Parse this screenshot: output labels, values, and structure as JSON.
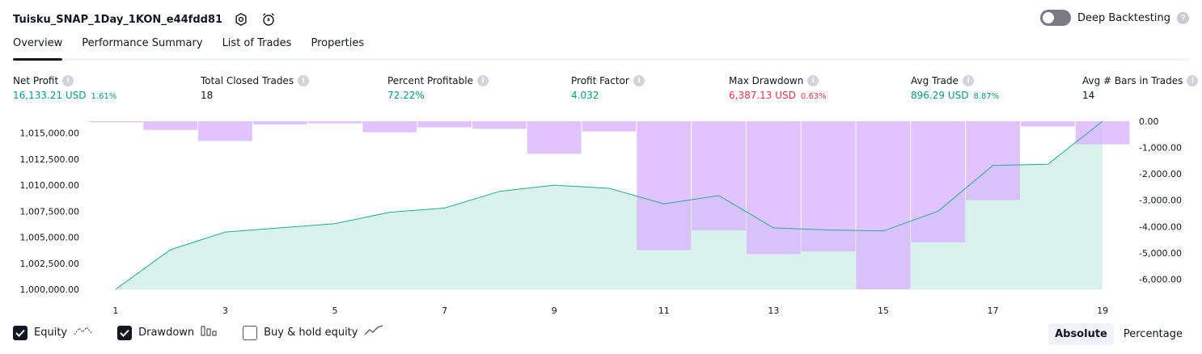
{
  "header": {
    "strategy_name": "Tuisku_SNAP_1Day_1KON_e44fdd81",
    "settings_icon": "gear-icon",
    "alert_icon": "alarm-clock-icon"
  },
  "deep_backtesting": {
    "label": "Deep Backtesting",
    "enabled": false
  },
  "tabs": [
    {
      "label": "Overview",
      "active": true
    },
    {
      "label": "Performance Summary",
      "active": false
    },
    {
      "label": "List of Trades",
      "active": false
    },
    {
      "label": "Properties",
      "active": false
    }
  ],
  "metrics": [
    {
      "label": "Net Profit",
      "value": "16,133.21 USD",
      "pct": "1.61%",
      "color": "green"
    },
    {
      "label": "Total Closed Trades",
      "value": "18",
      "pct": "",
      "color": "dark"
    },
    {
      "label": "Percent Profitable",
      "value": "72.22%",
      "pct": "",
      "color": "green"
    },
    {
      "label": "Profit Factor",
      "value": "4.032",
      "pct": "",
      "color": "green"
    },
    {
      "label": "Max Drawdown",
      "value": "6,387.13 USD",
      "pct": "0.63%",
      "color": "red"
    },
    {
      "label": "Avg Trade",
      "value": "896.29 USD",
      "pct": "8.87%",
      "color": "green"
    },
    {
      "label": "Avg # Bars in Trades",
      "value": "14",
      "pct": "",
      "color": "dark"
    }
  ],
  "chart_data": {
    "type": "area",
    "x": [
      1,
      2,
      3,
      4,
      5,
      6,
      7,
      8,
      9,
      10,
      11,
      12,
      13,
      14,
      15,
      16,
      17,
      18,
      19
    ],
    "x_ticks": [
      "1",
      "3",
      "5",
      "7",
      "9",
      "11",
      "13",
      "15",
      "17",
      "19"
    ],
    "series": [
      {
        "axis": "left",
        "type": "area",
        "values": [
          1000000,
          1003800,
          1005500,
          1005900,
          1006300,
          1007400,
          1007800,
          1009400,
          1010000,
          1009700,
          1008200,
          1009000,
          1005900,
          1005700,
          1005600,
          1007500,
          1011900,
          1012000,
          1016133
        ],
        "color": "#22ab94",
        "fill": "#cdeee6"
      },
      {
        "axis": "right",
        "type": "bar",
        "values": [
          -40,
          -330,
          -750,
          -120,
          -80,
          -420,
          -230,
          -290,
          -1240,
          -390,
          -4900,
          -4150,
          -5050,
          -4950,
          -6387,
          -4600,
          -3000,
          -200,
          -880
        ],
        "color": "#d8b4fe"
      }
    ],
    "left_axis": {
      "ticks": [
        "1,000,000.00",
        "1,002,500.00",
        "1,005,000.00",
        "1,007,500.00",
        "1,010,000.00",
        "1,012,500.00",
        "1,015,000.00"
      ],
      "range": [
        1000000,
        1016133
      ]
    },
    "right_axis": {
      "ticks": [
        "0.00",
        "-1,000.00",
        "-2,000.00",
        "-3,000.00",
        "-4,000.00",
        "-5,000.00",
        "-6,000.00"
      ],
      "range": [
        -6387.13,
        0
      ]
    }
  },
  "legend": [
    {
      "label": "Equity",
      "checked": true,
      "icon": "equity-line-icon"
    },
    {
      "label": "Drawdown",
      "checked": true,
      "icon": "drawdown-bars-icon"
    },
    {
      "label": "Buy & hold equity",
      "checked": false,
      "icon": "buy-hold-line-icon"
    }
  ],
  "modes": [
    {
      "label": "Absolute",
      "active": true
    },
    {
      "label": "Percentage",
      "active": false
    }
  ]
}
